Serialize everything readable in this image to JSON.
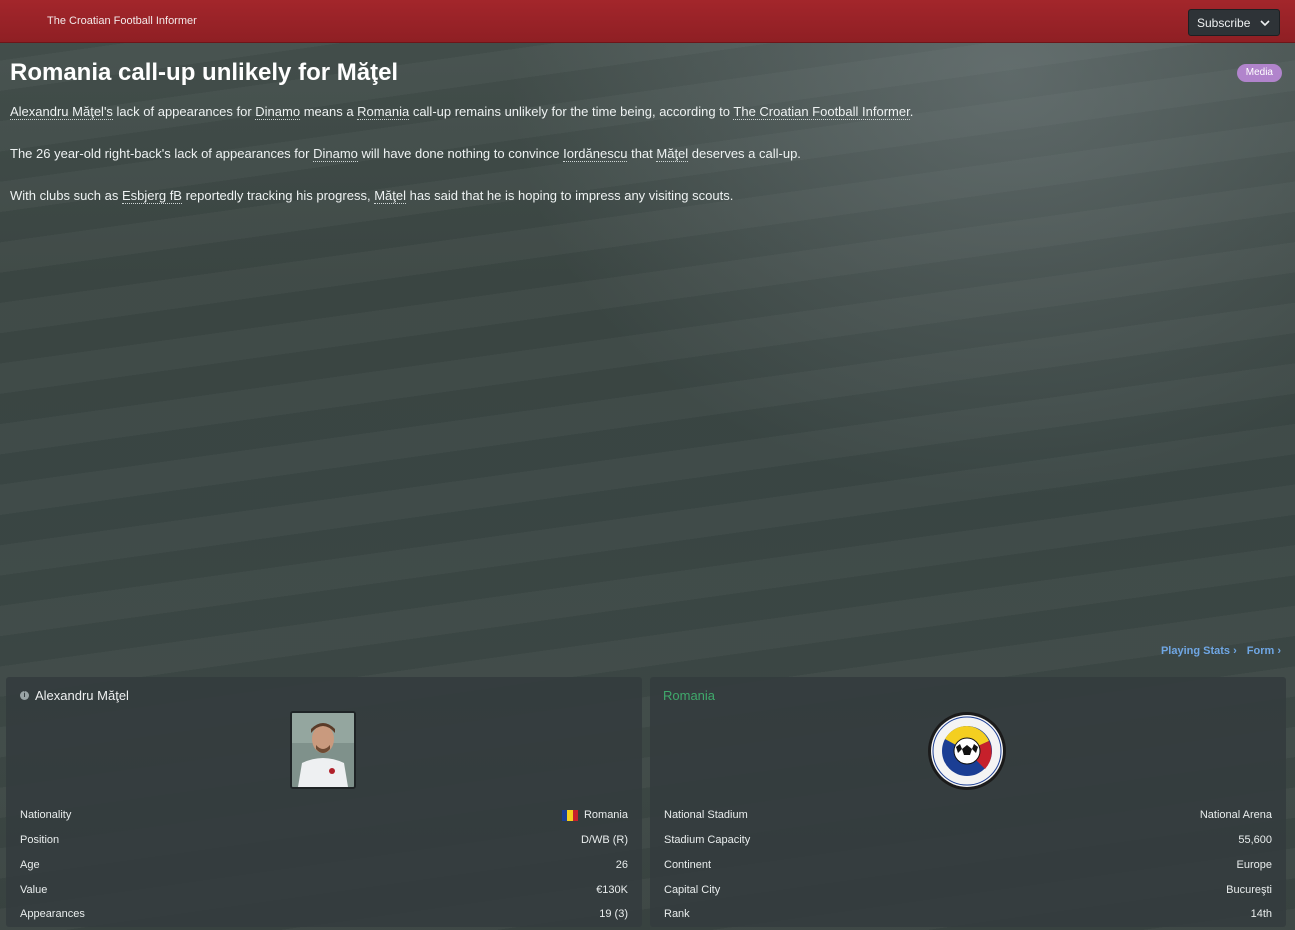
{
  "header": {
    "source": "The Croatian Football Informer",
    "subscribe_label": "Subscribe"
  },
  "article": {
    "headline": "Romania call-up unlikely for Măţel",
    "badge": "Media",
    "p1": {
      "name": "Alexandru Măţel's",
      "t1": " lack of appearances for ",
      "club": "Dinamo",
      "t2": " means a ",
      "country": "Romania",
      "t3": " call-up remains unlikely for the time being, according to ",
      "source": "The Croatian Football Informer",
      "t4": "."
    },
    "p2": {
      "t1": "The 26 year-old right-back's lack of appearances for ",
      "club": "Dinamo",
      "t2": " will have done nothing to convince ",
      "coach": "Iordănescu",
      "t3": " that ",
      "player": "Măţel",
      "t4": " deserves a call-up."
    },
    "p3": {
      "t1": "With clubs such as ",
      "club": "Esbjerg fB",
      "t2": " reportedly tracking his progress, ",
      "player": "Măţel",
      "t3": " has said that he is hoping to impress any visiting scouts."
    }
  },
  "links": {
    "playing_stats": "Playing Stats",
    "form": "Form"
  },
  "player_panel": {
    "name": "Alexandru Măţel",
    "rows": [
      {
        "label": "Nationality",
        "value": "Romania"
      },
      {
        "label": "Position",
        "value": "D/WB (R)"
      },
      {
        "label": "Age",
        "value": "26"
      },
      {
        "label": "Value",
        "value": "€130K"
      },
      {
        "label": "Appearances",
        "value": "19 (3)"
      }
    ]
  },
  "nation_panel": {
    "name": "Romania",
    "rows": [
      {
        "label": "National Stadium",
        "value": "National Arena"
      },
      {
        "label": "Stadium Capacity",
        "value": "55,600"
      },
      {
        "label": "Continent",
        "value": "Europe"
      },
      {
        "label": "Capital City",
        "value": "Bucureşti"
      },
      {
        "label": "Rank",
        "value": "14th"
      }
    ]
  },
  "colors": {
    "header_red": "#a3262b",
    "link_blue": "#6fa6e4",
    "nation_green": "#3fa96b",
    "badge_purple": "#b184cc"
  }
}
